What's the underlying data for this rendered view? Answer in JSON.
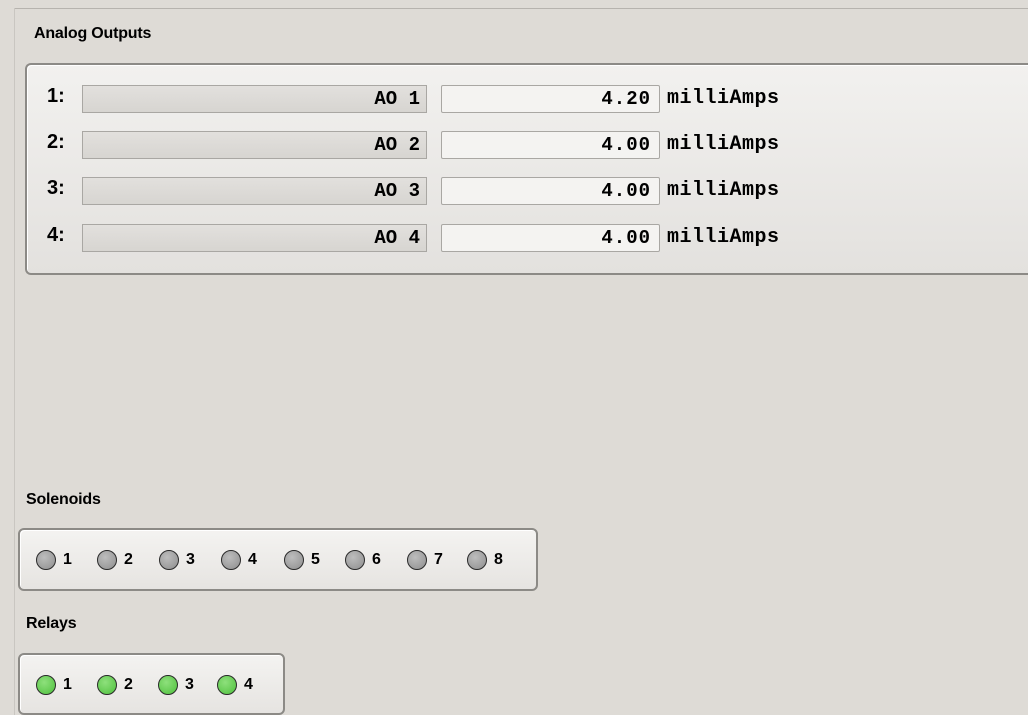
{
  "analog_outputs": {
    "title": "Analog Outputs",
    "rows": [
      {
        "index": "1:",
        "name": "AO 1",
        "value": "4.20",
        "unit": "milliAmps"
      },
      {
        "index": "2:",
        "name": "AO 2",
        "value": "4.00",
        "unit": "milliAmps"
      },
      {
        "index": "3:",
        "name": "AO 3",
        "value": "4.00",
        "unit": "milliAmps"
      },
      {
        "index": "4:",
        "name": "AO 4",
        "value": "4.00",
        "unit": "milliAmps"
      }
    ]
  },
  "solenoids": {
    "title": "Solenoids",
    "items": [
      {
        "label": "1",
        "state": "off",
        "color": "#9a9a9a"
      },
      {
        "label": "2",
        "state": "off",
        "color": "#9a9a9a"
      },
      {
        "label": "3",
        "state": "off",
        "color": "#9a9a9a"
      },
      {
        "label": "4",
        "state": "off",
        "color": "#9a9a9a"
      },
      {
        "label": "5",
        "state": "off",
        "color": "#9a9a9a"
      },
      {
        "label": "6",
        "state": "off",
        "color": "#9a9a9a"
      },
      {
        "label": "7",
        "state": "off",
        "color": "#9a9a9a"
      },
      {
        "label": "8",
        "state": "off",
        "color": "#9a9a9a"
      }
    ]
  },
  "relays": {
    "title": "Relays",
    "items": [
      {
        "label": "1",
        "state": "on",
        "color": "#5ccc48"
      },
      {
        "label": "2",
        "state": "on",
        "color": "#5ccc48"
      },
      {
        "label": "3",
        "state": "on",
        "color": "#5ccc48"
      },
      {
        "label": "4",
        "state": "on",
        "color": "#5ccc48"
      }
    ]
  }
}
